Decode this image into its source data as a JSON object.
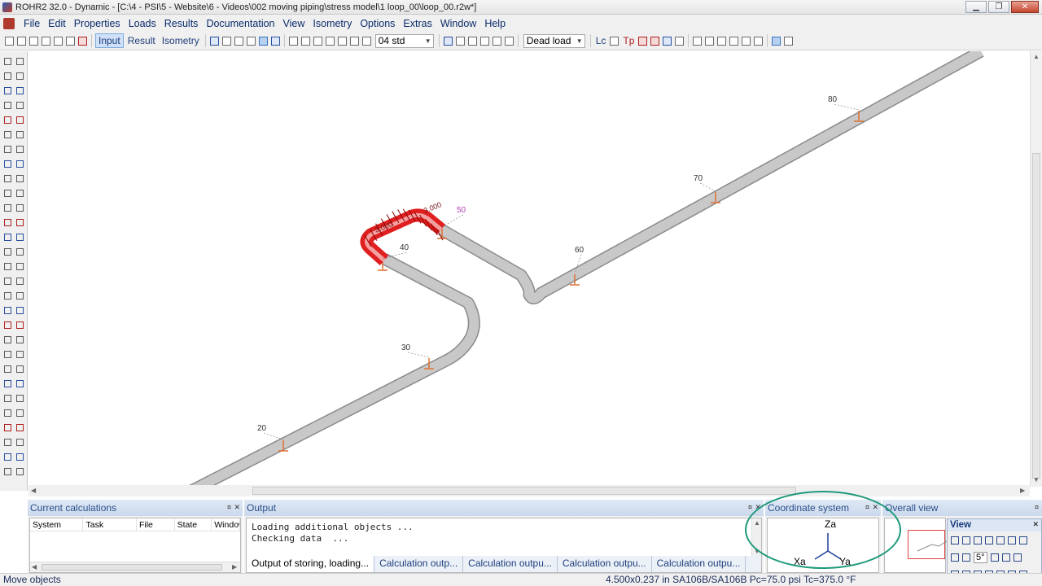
{
  "window": {
    "title": "ROHR2 32.0 - Dynamic - [C:\\4 - PSI\\5 - Website\\6 - Videos\\002 moving piping\\stress model\\1 loop_00\\loop_00.r2w*]",
    "minimize": "▁",
    "restore": "❐",
    "close": "✕"
  },
  "menu": [
    "File",
    "Edit",
    "Properties",
    "Loads",
    "Results",
    "Documentation",
    "View",
    "Isometry",
    "Options",
    "Extras",
    "Window",
    "Help"
  ],
  "toolbar": {
    "input_label": "Input",
    "result_label": "Result",
    "isometry_label": "Isometry",
    "std_combo": "04 std",
    "loadcase_combo": "Dead load",
    "lc_label": "Lc",
    "tp_label": "Tp"
  },
  "model": {
    "node_labels": [
      "20",
      "30",
      "40",
      "50",
      "60",
      "70",
      "80"
    ],
    "dim_labels": [
      "3.000",
      "3.000"
    ]
  },
  "panels": {
    "calculations": {
      "title": "Current calculations",
      "columns": [
        "System",
        "Task",
        "File",
        "State",
        "Window"
      ]
    },
    "output": {
      "title": "Output",
      "lines": [
        "Loading additional objects ...",
        "Checking data  ..."
      ],
      "tabs": [
        "Output of storing, loading...",
        "Calculation outp...",
        "Calculation outpu...",
        "Calculation outpu...",
        "Calculation outpu..."
      ]
    },
    "coordinate_system": {
      "title": "Coordinate system",
      "za": "Za",
      "xa": "Xa",
      "ya": "Ya"
    },
    "overall_view": {
      "title": "Overall view"
    },
    "view_palette": {
      "title": "View",
      "angle": "5°"
    }
  },
  "status": {
    "message": "Move objects",
    "info": "4.500x0.237 in SA106B/SA106B Pc=75.0 psi Tc=375.0 °F"
  },
  "colors": {
    "pipe": "#c8c8c8",
    "pipe_edge": "#8a8a8a",
    "selected": "#e02020",
    "support": "#e07030",
    "dim_label": "#b040b0",
    "annotation": "#1e9a7a"
  }
}
